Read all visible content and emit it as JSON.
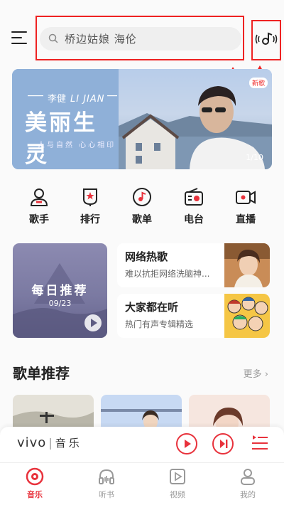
{
  "search": {
    "placeholder": "桥边姑娘 海伦"
  },
  "banner": {
    "subtitle_cn": "李健",
    "subtitle_en": "LI JIAN",
    "title": "美丽生灵",
    "caption": "人与自然 心心相印",
    "tag": "新歌",
    "page_indicator": "1/10"
  },
  "nav": [
    {
      "label": "歌手",
      "icon": "singer-icon"
    },
    {
      "label": "排行",
      "icon": "ranking-icon"
    },
    {
      "label": "歌单",
      "icon": "playlist-icon"
    },
    {
      "label": "电台",
      "icon": "radio-icon"
    },
    {
      "label": "直播",
      "icon": "live-icon"
    }
  ],
  "daily": {
    "title": "每日推荐",
    "date": "09/23"
  },
  "cards": [
    {
      "title": "网络热歌",
      "subtitle": "难以抗拒网络洗脑神..."
    },
    {
      "title": "大家都在听",
      "subtitle": "热门有声专辑精选"
    }
  ],
  "section": {
    "title": "歌单推荐",
    "more": "更多 ›"
  },
  "player": {
    "brand": "vivo",
    "separator": "|",
    "brand_cn": "音乐"
  },
  "tabs": [
    {
      "label": "音乐",
      "icon": "music-disc-icon",
      "active": true
    },
    {
      "label": "听书",
      "icon": "headphones-icon",
      "active": false
    },
    {
      "label": "视频",
      "icon": "video-icon",
      "active": false
    },
    {
      "label": "我的",
      "icon": "user-icon",
      "active": false
    }
  ],
  "colors": {
    "accent": "#e8323c",
    "annotation": "#e22222"
  }
}
